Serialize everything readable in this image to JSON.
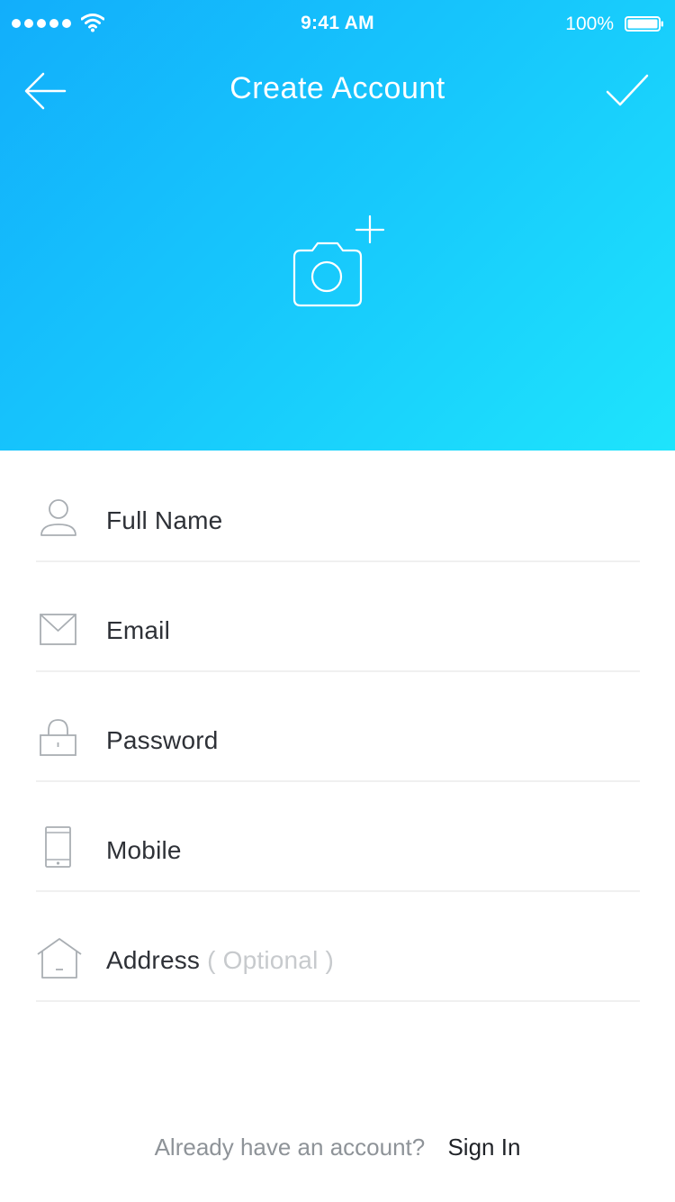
{
  "status_bar": {
    "time": "9:41 AM",
    "battery": "100%"
  },
  "nav": {
    "title": "Create Account"
  },
  "form": {
    "fields": [
      {
        "label": "Full Name",
        "icon": "user-icon"
      },
      {
        "label": "Email",
        "icon": "envelope-icon"
      },
      {
        "label": "Password",
        "icon": "lock-icon"
      },
      {
        "label": "Mobile",
        "icon": "mobile-phone-icon"
      },
      {
        "label": "Address",
        "icon": "home-icon",
        "note": "( Optional )"
      }
    ]
  },
  "footer": {
    "question": "Already have an account?",
    "sign_in": "Sign In"
  },
  "colors": {
    "header_gradient_start": "#12aefb",
    "header_gradient_end": "#1ee4fc",
    "text_dark": "#2e3137",
    "text_muted": "#8e9398",
    "placeholder_light": "#c7cacd"
  }
}
